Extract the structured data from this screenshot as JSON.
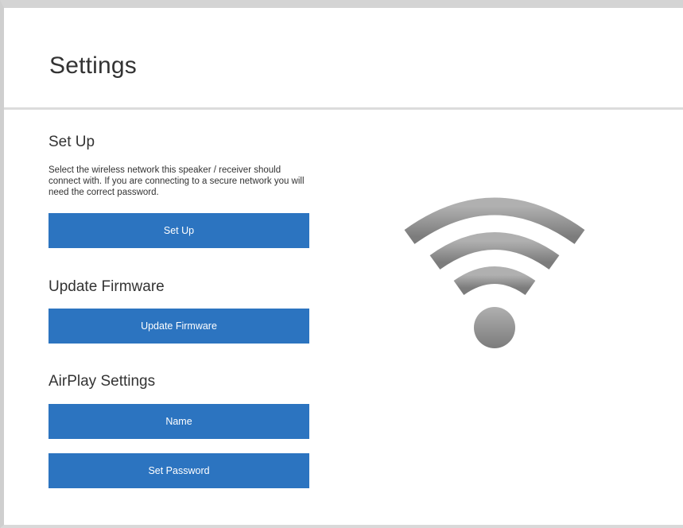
{
  "header": {
    "title": "Settings"
  },
  "setup": {
    "title": "Set Up",
    "description": "Select the wireless network this speaker / receiver should connect with. If you are connecting to a secure network you will need the correct password.",
    "button_label": "Set Up"
  },
  "firmware": {
    "title": "Update Firmware",
    "button_label": "Update Firmware"
  },
  "airplay": {
    "title": "AirPlay Settings",
    "name_button_label": "Name",
    "password_button_label": "Set Password"
  },
  "illustration": {
    "icon": "wifi-icon"
  },
  "colors": {
    "button_blue": "#2c74c0",
    "wifi_gray": "#8f8f8f",
    "divider": "#dcdcdc"
  }
}
